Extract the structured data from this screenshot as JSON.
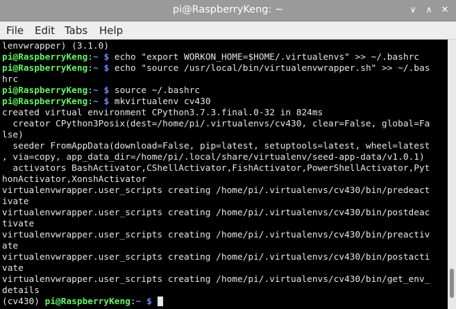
{
  "window": {
    "title": "pi@RaspberryKeng: ~",
    "minimize_glyph": "∨",
    "maximize_glyph": "∧",
    "close_glyph": "✕"
  },
  "menu": {
    "items": [
      "File",
      "Edit",
      "Tabs",
      "Help"
    ]
  },
  "prompt": {
    "user_host": "pi@RaspberryKeng",
    "colon": ":",
    "path": "~",
    "dollar": "$"
  },
  "venv_prefix": "(cv430) ",
  "commands": [
    " echo \"export WORKON_HOME=$HOME/.virtualenvs\" >> ~/.bashrc",
    " echo \"source /usr/local/bin/virtualenvwrapper.sh\" >> ~/.bas",
    " source ~/.bashrc",
    " mkvirtualenv cv430"
  ],
  "lines": [
    "lenvwrapper) (3.1.0)",
    "hrc",
    "created virtual environment CPython3.7.3.final.0-32 in 824ms",
    "  creator CPython3Posix(dest=/home/pi/.virtualenvs/cv430, clear=False, global=Fa",
    "lse)",
    "  seeder FromAppData(download=False, pip=latest, setuptools=latest, wheel=latest",
    ", via=copy, app_data_dir=/home/pi/.local/share/virtualenv/seed-app-data/v1.0.1)",
    "  activators BashActivator,CShellActivator,FishActivator,PowerShellActivator,Pyt",
    "honActivator,XonshActivator",
    "virtualenvwrapper.user_scripts creating /home/pi/.virtualenvs/cv430/bin/predeact",
    "ivate",
    "virtualenvwrapper.user_scripts creating /home/pi/.virtualenvs/cv430/bin/postdeac",
    "tivate",
    "virtualenvwrapper.user_scripts creating /home/pi/.virtualenvs/cv430/bin/preactiv",
    "ate",
    "virtualenvwrapper.user_scripts creating /home/pi/.virtualenvs/cv430/bin/postacti",
    "vate",
    "virtualenvwrapper.user_scripts creating /home/pi/.virtualenvs/cv430/bin/get_env_",
    "details"
  ],
  "colors": {
    "titlebar": "#9a9a9a",
    "background": "#000000",
    "text": "#e6e6e6",
    "prompt_user": "#5ef95e",
    "prompt_path": "#6b8cff"
  }
}
